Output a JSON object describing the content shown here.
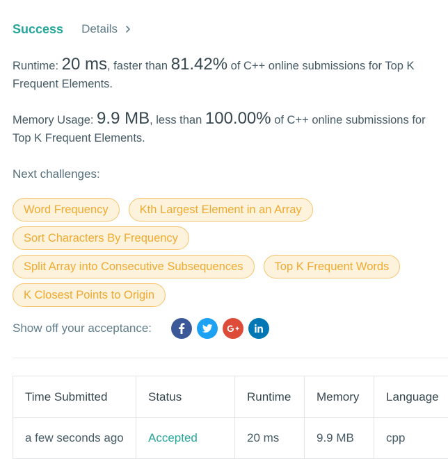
{
  "header": {
    "status": "Success",
    "details_label": "Details"
  },
  "runtime": {
    "label": "Runtime: ",
    "value": "20 ms",
    "comparison": ", faster than ",
    "percent": "81.42%",
    "tail": " of C++ online submissions for Top K Frequent Elements."
  },
  "memory": {
    "label": "Memory Usage: ",
    "value": "9.9 MB",
    "comparison": ", less than ",
    "percent": "100.00%",
    "tail": " of C++ online submissions for Top K Frequent Elements."
  },
  "next": {
    "label": "Next challenges:",
    "challenges": [
      "Word Frequency",
      "Kth Largest Element in an Array",
      "Sort Characters By Frequency",
      "Split Array into Consecutive Subsequences",
      "Top K Frequent Words",
      "K Closest Points to Origin"
    ]
  },
  "share": {
    "label": "Show off your acceptance:",
    "icons": [
      {
        "name": "facebook-icon",
        "color": "#3b5998"
      },
      {
        "name": "twitter-icon",
        "color": "#1da1f2"
      },
      {
        "name": "google-plus-icon",
        "color": "#dd4b39"
      },
      {
        "name": "linkedin-icon",
        "color": "#0077b5"
      }
    ]
  },
  "table": {
    "headers": [
      "Time Submitted",
      "Status",
      "Runtime",
      "Memory",
      "Language"
    ],
    "rows": [
      {
        "time": "a few seconds ago",
        "status": "Accepted",
        "runtime": "20 ms",
        "memory": "9.9 MB",
        "language": "cpp"
      }
    ]
  },
  "colors": {
    "success": "#26a69a",
    "pill_text": "#f0a92f",
    "pill_bg": "#fdf3dd",
    "pill_border": "#f5c26b"
  }
}
